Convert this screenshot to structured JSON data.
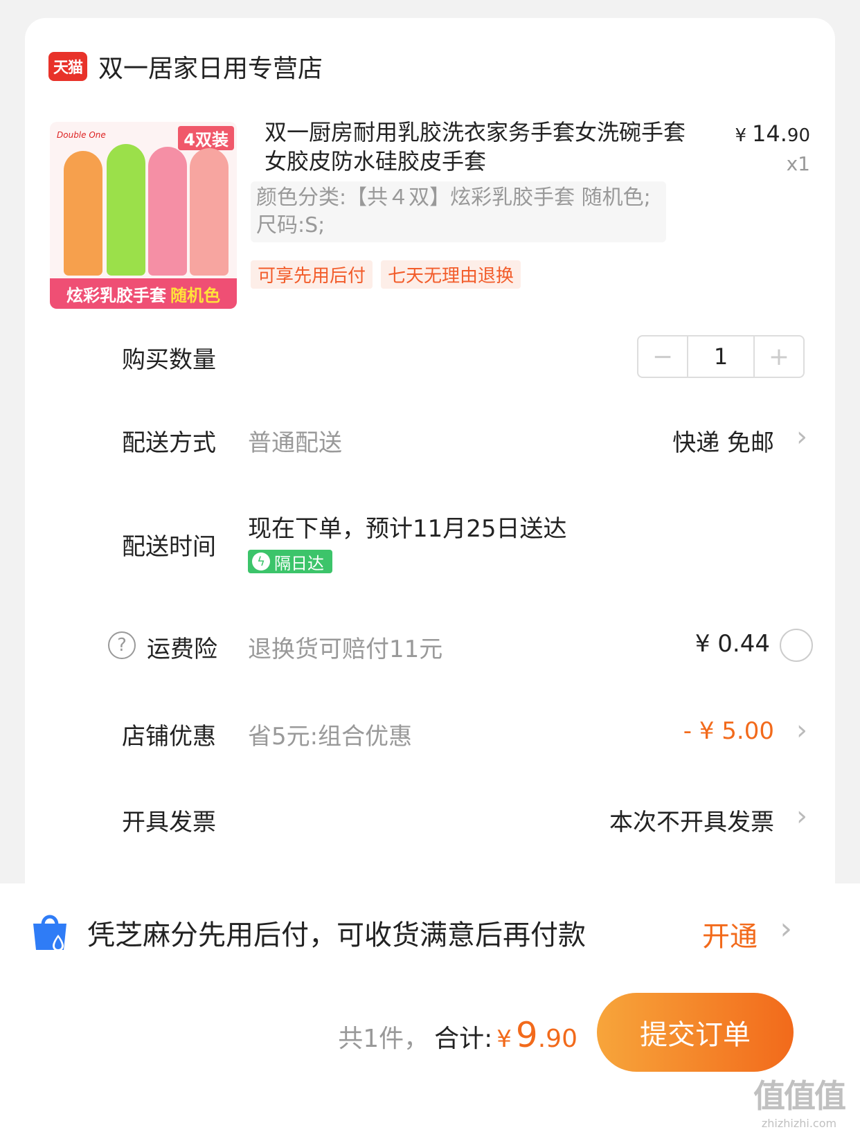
{
  "shop": {
    "badge": "天猫",
    "name": "双一居家日用专营店"
  },
  "product": {
    "image": {
      "pack_tag": "4双装",
      "brand": "Double One",
      "banner_text": "炫彩乳胶手套",
      "banner_highlight": "随机色",
      "glove_colors": [
        "#f6a04d",
        "#9be04a",
        "#f58fa5",
        "#f7a5a0"
      ]
    },
    "title": "双一厨房耐用乳胶洗衣家务手套女洗碗手套女胶皮防水硅胶皮手套",
    "price_currency": "¥",
    "price_int": "14.",
    "price_dec": "90",
    "qty": "x1",
    "sku": "颜色分类:【共４双】炫彩乳胶手套 随机色;尺码:S;",
    "tags": [
      "可享先用后付",
      "七天无理由退换"
    ]
  },
  "quantity": {
    "label": "购买数量",
    "minus": "−",
    "value": "1",
    "plus": "+"
  },
  "delivery": {
    "label": "配送方式",
    "sub": "普通配送",
    "value": "快递 免邮",
    "chevron": "›"
  },
  "delivery_time": {
    "label": "配送时间",
    "text": "现在下单，预计11月25日送达",
    "badge": "隔日达",
    "badge_icon": "ϟ"
  },
  "insurance": {
    "label": "运费险",
    "help": "?",
    "sub": "退换货可赔付11元",
    "value": "¥ 0.44"
  },
  "discount": {
    "label": "店铺优惠",
    "sub": "省5元:组合优惠",
    "value": "- ¥ 5.00",
    "chevron": "›"
  },
  "invoice": {
    "label": "开具发票",
    "value": "本次不开具发票",
    "chevron": "›"
  },
  "pay_later": {
    "text": "凭芝麻分先用后付，可收货满意后再付款",
    "action": "开通",
    "chevron": "›"
  },
  "summary": {
    "count": "共1件，",
    "total_label": "合计:",
    "currency": "¥",
    "total_int": "9",
    "total_dec": ".90"
  },
  "submit": {
    "label": "提交订单"
  },
  "watermark": {
    "big": "值值值",
    "small": "zhizhizhi.com"
  },
  "colors": {
    "accent": "#f26a1b",
    "tmall_red": "#e8322a",
    "green": "#3cc46a"
  }
}
